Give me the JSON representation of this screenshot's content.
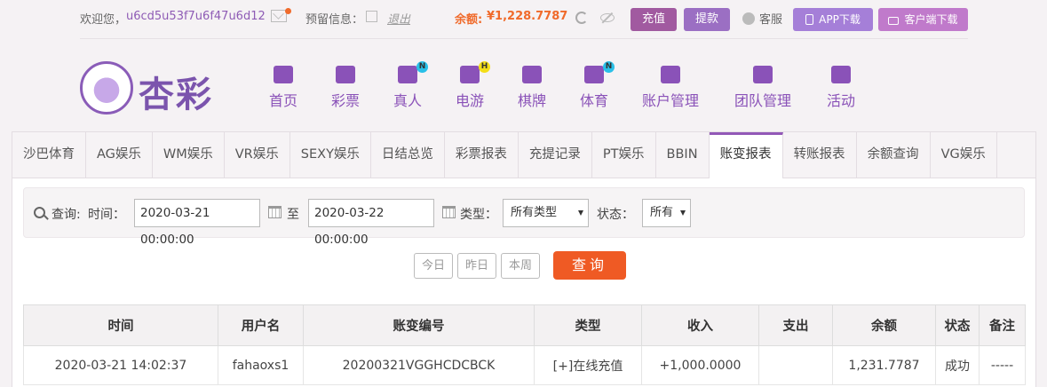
{
  "topbar": {
    "welcome": "欢迎您，",
    "username": "u6cd5u53f7u6f47u6d12",
    "notice_label": "预留信息：",
    "logout": "退出",
    "balance_label": "余额:",
    "balance_value": "¥1,228.7787",
    "deposit": "充值",
    "withdraw": "提款",
    "customer_service": "客服",
    "app_download": "APP下载",
    "client_download": "客户端下载"
  },
  "logo": {
    "text": "杏彩"
  },
  "nav": [
    {
      "label": "首页",
      "icon": "home-icon",
      "badge": ""
    },
    {
      "label": "彩票",
      "icon": "lottery-icon",
      "badge": ""
    },
    {
      "label": "真人",
      "icon": "live-dealer-icon",
      "badge": "N"
    },
    {
      "label": "电游",
      "icon": "gamepad-icon",
      "badge": "H"
    },
    {
      "label": "棋牌",
      "icon": "cards-icon",
      "badge": ""
    },
    {
      "label": "体育",
      "icon": "trophy-icon",
      "badge": "N"
    },
    {
      "label": "账户管理",
      "icon": "account-icon",
      "badge": ""
    },
    {
      "label": "团队管理",
      "icon": "team-icon",
      "badge": ""
    },
    {
      "label": "活动",
      "icon": "gift-icon",
      "badge": ""
    }
  ],
  "tabs": [
    {
      "label": "沙巴体育",
      "active": false
    },
    {
      "label": "AG娱乐",
      "active": false
    },
    {
      "label": "WM娱乐",
      "active": false
    },
    {
      "label": "VR娱乐",
      "active": false
    },
    {
      "label": "SEXY娱乐",
      "active": false
    },
    {
      "label": "日结总览",
      "active": false
    },
    {
      "label": "彩票报表",
      "active": false
    },
    {
      "label": "充提记录",
      "active": false
    },
    {
      "label": "PT娱乐",
      "active": false
    },
    {
      "label": "BBIN",
      "active": false
    },
    {
      "label": "账变报表",
      "active": true
    },
    {
      "label": "转账报表",
      "active": false
    },
    {
      "label": "余额查询",
      "active": false
    },
    {
      "label": "VG娱乐",
      "active": false
    }
  ],
  "query": {
    "label": "查询:",
    "time_label": "时间：",
    "start_time": "2020-03-21 00:00:00",
    "to_label": "至",
    "end_time": "2020-03-22 00:00:00",
    "type_label": "类型：",
    "type_value": "所有类型",
    "status_label": "状态：",
    "status_value": "所有",
    "today": "今日",
    "yesterday": "昨日",
    "this_week": "本周",
    "search_button": "查询"
  },
  "table": {
    "headers": [
      "时间",
      "用户名",
      "账变编号",
      "类型",
      "收入",
      "支出",
      "余额",
      "状态",
      "备注"
    ],
    "rows": [
      [
        "2020-03-21 14:02:37",
        "fahaoxs1",
        "20200321VGGHCDCBCK",
        "[+]在线充值",
        "+1,000.0000",
        "",
        "1,231.7787",
        "成功",
        "-----"
      ]
    ]
  },
  "colors": {
    "brand_purple": "#8a52b8",
    "accent_orange": "#ef5a24",
    "income_green": "#5aa02c"
  }
}
